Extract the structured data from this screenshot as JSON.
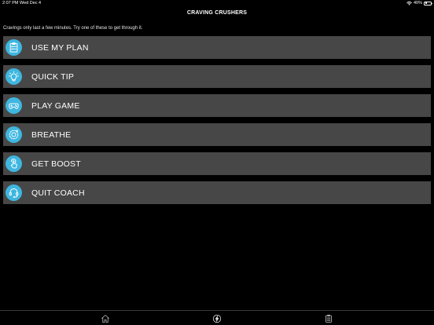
{
  "status_bar": {
    "time": "2:07 PM",
    "date": "Wed Dec 4",
    "battery_percent_label": "40%",
    "battery_level": 0.4
  },
  "header": {
    "title": "CRAVING CRUSHERS"
  },
  "main": {
    "subtitle": "Cravings only last a few minutes. Try one of these to get through it.",
    "accent_color": "#3eb6e0",
    "item_background": "#474747",
    "items": [
      {
        "label": "USE MY PLAN",
        "icon": "clipboard-checklist-icon"
      },
      {
        "label": "QUICK TIP",
        "icon": "lightbulb-icon"
      },
      {
        "label": "PLAY GAME",
        "icon": "gamepad-icon"
      },
      {
        "label": "BREATHE",
        "icon": "breathe-circle-icon"
      },
      {
        "label": "GET BOOST",
        "icon": "tap-hand-icon"
      },
      {
        "label": "QUIT COACH",
        "icon": "headset-icon"
      }
    ]
  },
  "tab_bar": {
    "tabs": [
      {
        "icon": "home-icon"
      },
      {
        "icon": "lightning-icon"
      },
      {
        "icon": "clipboard-icon"
      }
    ]
  }
}
